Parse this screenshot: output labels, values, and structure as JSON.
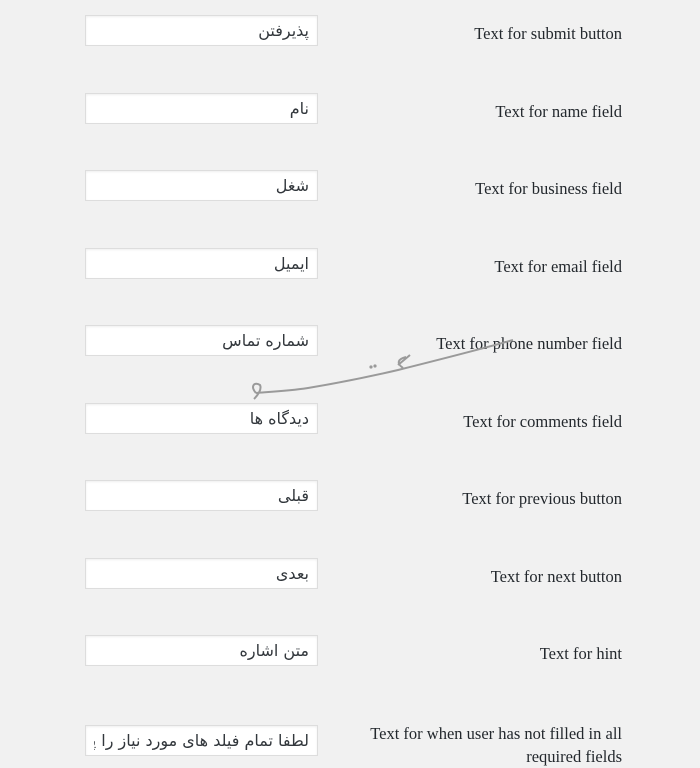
{
  "fields": [
    {
      "label": "Text for submit button",
      "value": "پذیرفتن"
    },
    {
      "label": "Text for name field",
      "value": "نام"
    },
    {
      "label": "Text for business field",
      "value": "شغل"
    },
    {
      "label": "Text for email field",
      "value": "ایمیل"
    },
    {
      "label": "Text for phone number field",
      "value": "شماره تماس"
    },
    {
      "label": "Text for comments field",
      "value": "دیدگاه ها"
    },
    {
      "label": "Text for previous button",
      "value": "قبلی"
    },
    {
      "label": "Text for next button",
      "value": "بعدی"
    },
    {
      "label": "Text for hint",
      "value": "متن اشاره"
    },
    {
      "label": "Text for when user has not filled in all required fields",
      "value": "لطفا تمام فیلد های مورد نیاز را پر کنید"
    }
  ],
  "watermark": {
    "text": "تیک تم",
    "color": "#9a9a9a"
  }
}
